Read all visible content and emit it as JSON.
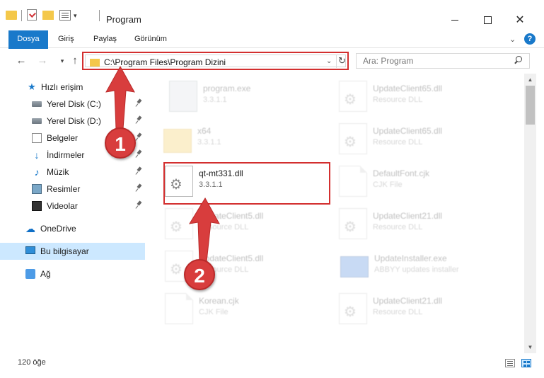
{
  "window": {
    "title": "Program",
    "minimize_label": "",
    "close_glyph": "✕"
  },
  "ribbon": {
    "tabs": [
      "Dosya",
      "Giriş",
      "Paylaş",
      "Görünüm"
    ],
    "collapse_glyph": "⌄",
    "help_glyph": "?"
  },
  "nav": {
    "back_glyph": "←",
    "forward_glyph": "→",
    "recent_glyph": "▾",
    "up_glyph": "↑",
    "address": "C:\\Program Files\\Program Dizini",
    "address_dropdown_glyph": "⌄",
    "refresh_glyph": "↻",
    "search_placeholder": "Ara: Program"
  },
  "sidebar": {
    "items": [
      {
        "label": "Hızlı erişim",
        "icon": "star-icon"
      },
      {
        "label": "Yerel Disk (C:)",
        "icon": "drive-icon",
        "pinned": true
      },
      {
        "label": "Yerel Disk (D:)",
        "icon": "drive-icon",
        "pinned": true
      },
      {
        "label": "Belgeler",
        "icon": "documents-icon",
        "pinned": true
      },
      {
        "label": "İndirmeler",
        "icon": "download-icon",
        "pinned": true
      },
      {
        "label": "Müzik",
        "icon": "music-icon",
        "pinned": true
      },
      {
        "label": "Resimler",
        "icon": "pictures-icon",
        "pinned": true
      },
      {
        "label": "Videolar",
        "icon": "videos-icon",
        "pinned": true
      },
      {
        "label": "OneDrive",
        "icon": "onedrive-icon"
      },
      {
        "label": "Bu bilgisayar",
        "icon": "computer-icon",
        "selected": true
      },
      {
        "label": "Ağ",
        "icon": "network-icon"
      }
    ]
  },
  "files": [
    {
      "name": "program.exe",
      "sub": "3.3.1.1",
      "icon": "exe-icon"
    },
    {
      "name": "UpdateClient65.dll",
      "sub": "Resource DLL",
      "icon": "dll-icon"
    },
    {
      "name": "x64",
      "sub": "3.3.1.1",
      "icon": "folder-icon"
    },
    {
      "name": "UpdateClient65.dll",
      "sub": "Resource DLL",
      "icon": "dll-icon"
    },
    {
      "name": "qt-mt331.dll",
      "sub": "3.3.1.1",
      "icon": "dll-icon"
    },
    {
      "name": "DefaultFont.cjk",
      "sub": "CJK File",
      "icon": "file-icon"
    },
    {
      "name": "UpdateClient5.dll",
      "sub": "Resource DLL",
      "icon": "dll-icon"
    },
    {
      "name": "UpdateClient21.dll",
      "sub": "Resource DLL",
      "icon": "dll-icon"
    },
    {
      "name": "UpdateClient5.dll",
      "sub": "Resource DLL",
      "icon": "dll-icon"
    },
    {
      "name": "UpdateInstaller.exe",
      "sub": "ABBYY updates installer",
      "icon": "installer-icon"
    },
    {
      "name": "Korean.cjk",
      "sub": "CJK File",
      "icon": "file-icon"
    },
    {
      "name": "UpdateClient21.dll",
      "sub": "Resource DLL",
      "icon": "dll-icon"
    }
  ],
  "status": {
    "item_count": "120 öğe"
  },
  "annotations": {
    "step1": "1",
    "step2": "2",
    "color": "#d83d3d"
  },
  "colors": {
    "accent": "#1979ca",
    "selection": "#cce8ff",
    "annotation_red": "#d32f2f"
  }
}
